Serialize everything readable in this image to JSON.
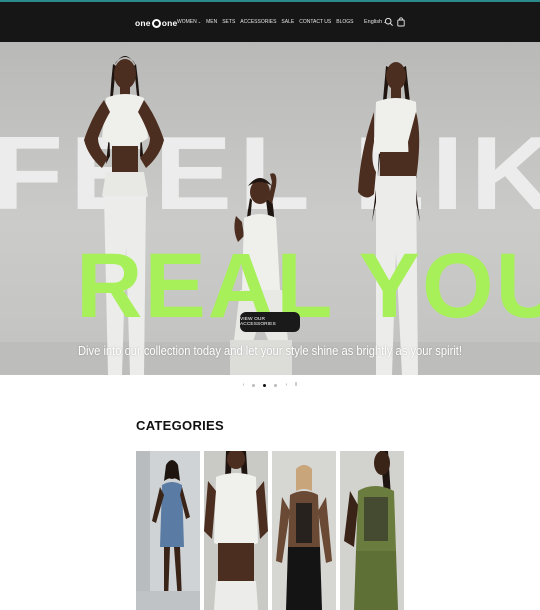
{
  "header": {
    "logo_left": "one",
    "logo_right": "one",
    "nav": [
      {
        "label": "WOMEN",
        "dropdown": true
      },
      {
        "label": "MEN",
        "dropdown": false
      },
      {
        "label": "SETS",
        "dropdown": false
      },
      {
        "label": "ACCESSORIES",
        "dropdown": false
      },
      {
        "label": "SALE",
        "dropdown": false
      },
      {
        "label": "CONTACT US",
        "dropdown": false
      },
      {
        "label": "BLOGS",
        "dropdown": false
      }
    ],
    "language": "English",
    "icons": [
      "search-icon",
      "bag-icon"
    ]
  },
  "hero": {
    "headline_line1": "FEEL LIKE",
    "headline_line2": "REAL YOU",
    "cta_label": "VIEW OUR ACCESSORIES",
    "subtext": "Dive into our collection today and let your style shine as brightly as your spirit!",
    "colors": {
      "headline_green": "#a8f05a",
      "headline_white": "#ececec"
    }
  },
  "slider": {
    "prev_icon": "chevron-left-icon",
    "next_icon": "chevron-right-icon",
    "pause_icon": "pause-icon",
    "slide_count": 3,
    "active_slide": 2
  },
  "categories": {
    "title": "CATEGORIES",
    "cards": [
      {
        "name": "denim-dress"
      },
      {
        "name": "lace-top-set"
      },
      {
        "name": "mesh-back-set"
      },
      {
        "name": "olive-sports-set"
      }
    ]
  }
}
